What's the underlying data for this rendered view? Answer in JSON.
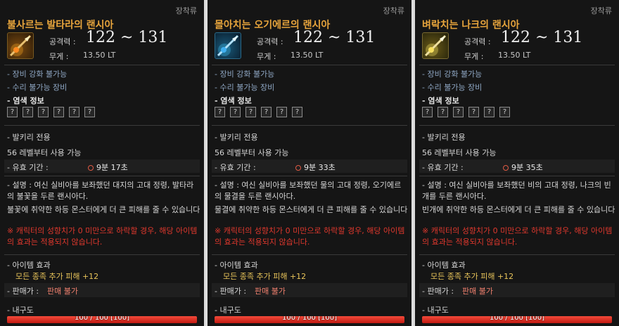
{
  "tooltips": [
    {
      "category": "장착류",
      "name": "불사르는 발타라의 랜시아",
      "icon": "fire-lance-icon",
      "attack_label": "공격력 :",
      "attack_value": "122 ~ 131",
      "weight_label": "무게 :",
      "weight_value": "13.50 LT",
      "line1": "- 장비 강화 불가능",
      "line2": "- 수리 불가능 장비",
      "dye_label": "- 염색 정보",
      "dye_slots": [
        "?",
        "?",
        "?",
        "?",
        "?",
        "?"
      ],
      "class_text": "- 발키리 전용",
      "level_text": "56 레벨부터 사용 가능",
      "period_label": "- 유효 기간 :",
      "period_value": "9분 17초",
      "desc1": "- 설명 : 여신 실비아를 보좌했던 대지의 고대 정령, 발타라의 불꽃을 두른 랜시아다.",
      "desc2": "불꽃에 취약한 하등 몬스터에게 더 큰 피해를 줄 수 있습니다",
      "warning": "※ 캐릭터의 성향치가 0 미만으로 하락할 경우, 해당 아이템의 효과는 적용되지 않습니다.",
      "effect_label": "- 아이템 효과",
      "effect_value": "모든 종족 추가 피해 +12",
      "sale_label": "- 판매가 :",
      "sale_value": "판매 불가",
      "durability_label": "- 내구도",
      "durability_text": "100 / 100 [100]",
      "durability_fraction": 1.0
    },
    {
      "category": "장착류",
      "name": "몰아치는 오기에르의 랜시아",
      "icon": "water-lance-icon",
      "attack_label": "공격력 :",
      "attack_value": "122 ~ 131",
      "weight_label": "무게 :",
      "weight_value": "13.50 LT",
      "line1": "- 장비 강화 불가능",
      "line2": "- 수리 불가능 장비",
      "dye_label": "- 염색 정보",
      "dye_slots": [
        "?",
        "?",
        "?",
        "?",
        "?",
        "?"
      ],
      "class_text": "- 발키리 전용",
      "level_text": "56 레벨부터 사용 가능",
      "period_label": "- 유효 기간 :",
      "period_value": "9분 33초",
      "desc1": "- 설명 : 여신 실비아를 보좌했던 물의 고대 정령, 오기에르의 물결을 두른 랜시아다.",
      "desc2": "물결에 취약한 하등 몬스터에게 더 큰 피해를 줄 수 있습니다",
      "warning": "※ 캐릭터의 성향치가 0 미만으로 하락할 경우, 해당 아이템의 효과는 적용되지 않습니다.",
      "effect_label": "- 아이템 효과",
      "effect_value": "모든 종족 추가 피해 +12",
      "sale_label": "- 판매가 :",
      "sale_value": "판매 불가",
      "durability_label": "- 내구도",
      "durability_text": "100 / 100 [100]",
      "durability_fraction": 1.0
    },
    {
      "category": "장착류",
      "name": "벼락치는 나크의 랜시아",
      "icon": "thunder-lance-icon",
      "attack_label": "공격력 :",
      "attack_value": "122 ~ 131",
      "weight_label": "무게 :",
      "weight_value": "13.50 LT",
      "line1": "- 장비 강화 불가능",
      "line2": "- 수리 불가능 장비",
      "dye_label": "- 염색 정보",
      "dye_slots": [
        "?",
        "?",
        "?",
        "?",
        "?",
        "?"
      ],
      "class_text": "- 발키리 전용",
      "level_text": "56 레벨부터 사용 가능",
      "period_label": "- 유효 기간 :",
      "period_value": "9분 35초",
      "desc1": "- 설명 : 여신 실비아를 보좌했던 비의 고대 정령, 나크의 빈개를 두른 랜시아다.",
      "desc2": "빈개에 취약한 하등 몬스터에게 더 큰 피해를 줄 수 있습니다",
      "warning": "※ 캐릭터의 성향치가 0 미만으로 하락할 경우, 해당 아이템의 효과는 적용되지 않습니다.",
      "effect_label": "- 아이템 효과",
      "effect_value": "모든 종족 추가 피해 +12",
      "sale_label": "- 판매가 :",
      "sale_value": "판매 불가",
      "durability_label": "- 내구도",
      "durability_text": "100 / 100 [100]",
      "durability_fraction": 1.0
    }
  ],
  "colors": {
    "item_name": "#e8a53c",
    "blue_text": "#8fa7c4",
    "warning": "#e0382d",
    "effect": "#e8c45a",
    "durability_bar": "#e0322a"
  }
}
